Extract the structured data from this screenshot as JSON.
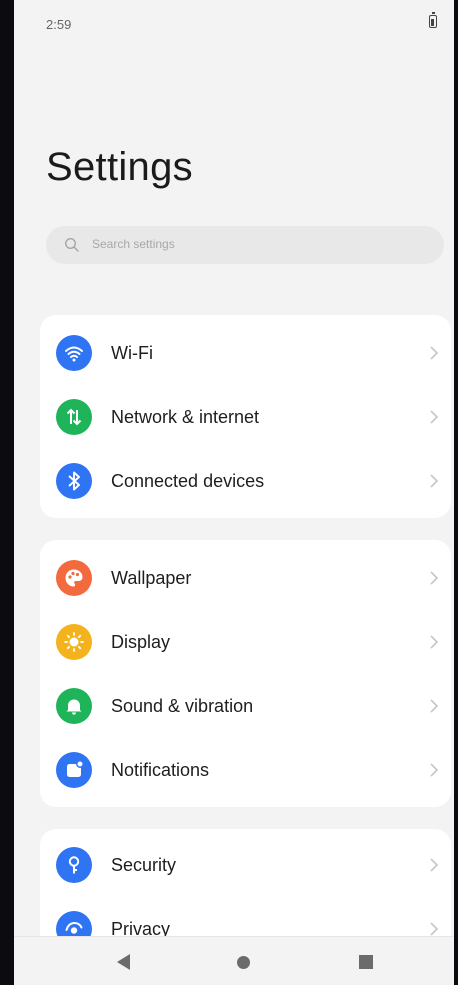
{
  "status_bar": {
    "time": "2:59"
  },
  "title": "Settings",
  "search": {
    "placeholder": "Search settings"
  },
  "groups": [
    [
      {
        "label": "Wi-Fi",
        "icon": "wifi-icon",
        "color": "#2f74f3"
      },
      {
        "label": "Network & internet",
        "icon": "network-arrows-icon",
        "color": "#1fb45a"
      },
      {
        "label": "Connected devices",
        "icon": "bluetooth-icon",
        "color": "#2f74f3"
      }
    ],
    [
      {
        "label": "Wallpaper",
        "icon": "palette-icon",
        "color": "#f26a3d"
      },
      {
        "label": "Display",
        "icon": "sun-icon",
        "color": "#f4b21c"
      },
      {
        "label": "Sound & vibration",
        "icon": "bell-icon",
        "color": "#1fb45a"
      },
      {
        "label": "Notifications",
        "icon": "notification-icon",
        "color": "#2f74f3"
      }
    ],
    [
      {
        "label": "Security",
        "icon": "key-icon",
        "color": "#2f74f3"
      },
      {
        "label": "Privacy",
        "icon": "privacy-icon",
        "color": "#2f74f3"
      }
    ]
  ]
}
